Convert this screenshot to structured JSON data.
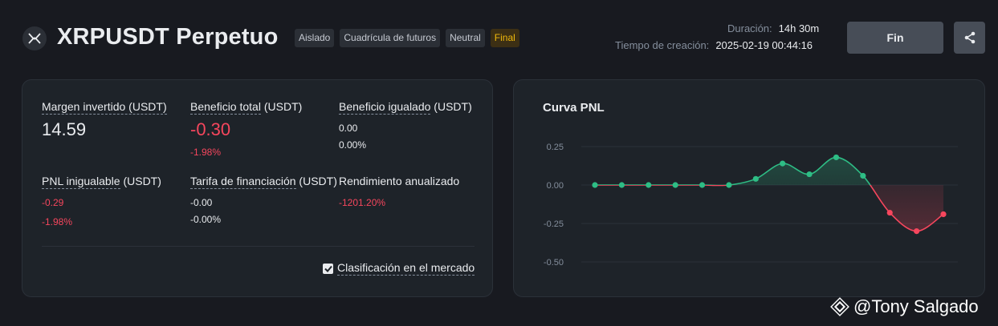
{
  "header": {
    "title": "XRPUSDT Perpetuo",
    "tags": [
      "Aislado",
      "Cuadrícula de futuros",
      "Neutral",
      "Final"
    ],
    "duration_label": "Duración:",
    "duration_value": "14h 30m",
    "created_label": "Tiempo de creación:",
    "created_value": "2025-02-19 00:44:16",
    "fin_label": "Fin"
  },
  "stats": {
    "margin": {
      "label": "Margen invertido",
      "unit": " (USDT)",
      "value": "14.59"
    },
    "profit": {
      "label": "Beneficio total",
      "unit": " (USDT)",
      "value": "-0.30",
      "pct": "-1.98%"
    },
    "matched": {
      "label": "Beneficio igualado",
      "unit": " (USDT)",
      "value": "0.00",
      "pct": "0.00%"
    },
    "unmatched": {
      "label": "PNL inigualable",
      "unit": " (USDT)",
      "value": "-0.29",
      "pct": "-1.98%"
    },
    "funding": {
      "label": "Tarifa de financiación",
      "unit": " (USDT)",
      "value": "-0.00",
      "pct": "-0.00%"
    },
    "annual": {
      "label": "Rendimiento anualizado",
      "value": "-1201.20%"
    },
    "market_label": "Clasificación en el mercado"
  },
  "chart_data": {
    "type": "line",
    "title": "Curva PNL",
    "y_ticks": [
      "0.25",
      "0.00",
      "-0.25",
      "-0.50"
    ],
    "ylim": [
      -0.5,
      0.25
    ],
    "values": [
      0.0,
      0.0,
      0.0,
      0.0,
      0.0,
      0.0,
      0.04,
      0.14,
      0.07,
      0.18,
      0.06,
      -0.18,
      -0.3,
      -0.19
    ],
    "positive_color": "#2ebd85",
    "negative_color": "#f6465d"
  },
  "watermark": "@Tony Salgado"
}
